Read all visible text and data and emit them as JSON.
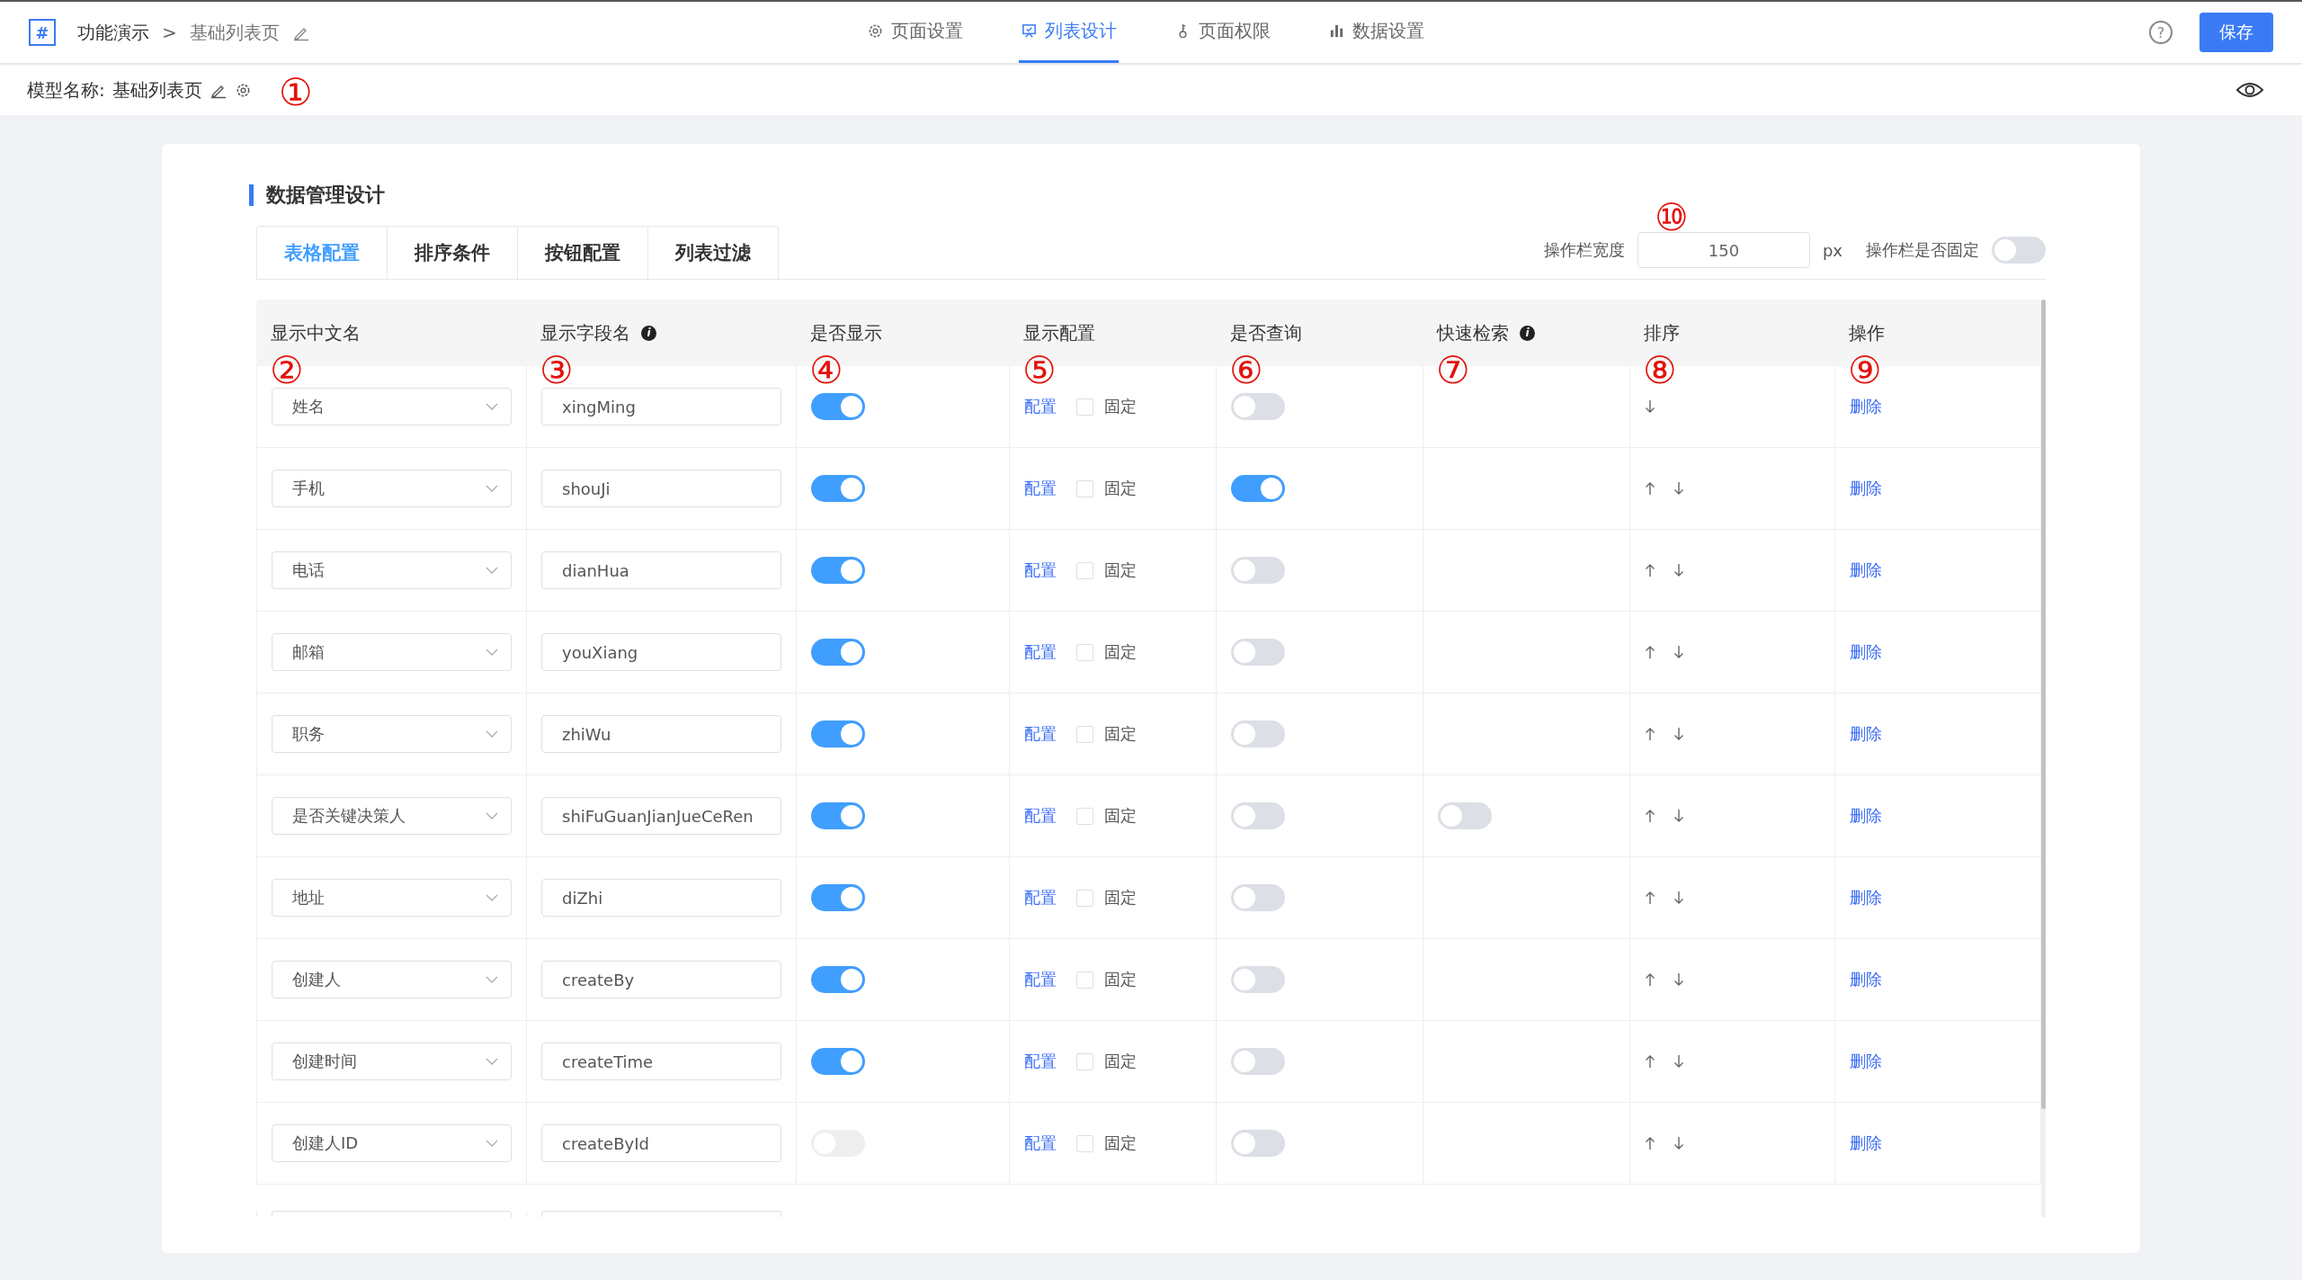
{
  "breadcrumb": {
    "logo": "#",
    "root": "功能演示",
    "separator": ">",
    "current": "基础列表页"
  },
  "nav_tabs": [
    {
      "label": "页面设置",
      "selected": false
    },
    {
      "label": "列表设计",
      "selected": true
    },
    {
      "label": "页面权限",
      "selected": false
    },
    {
      "label": "数据设置",
      "selected": false
    }
  ],
  "help": "?",
  "save_button": "保存",
  "model_name": {
    "label": "模型名称:",
    "value": "基础列表页",
    "callout": "①"
  },
  "section_title": "数据管理设计",
  "config_tabs": [
    {
      "label": "表格配置",
      "selected": true
    },
    {
      "label": "排序条件",
      "selected": false
    },
    {
      "label": "按钮配置",
      "selected": false
    },
    {
      "label": "列表过滤",
      "selected": false
    }
  ],
  "action_width": {
    "label": "操作栏宽度",
    "value": "150",
    "unit": "px",
    "callout": "⑩"
  },
  "action_fixed": {
    "label": "操作栏是否固定",
    "on": false
  },
  "columns": [
    {
      "label": "显示中文名",
      "callout": "②"
    },
    {
      "label": "显示字段名",
      "info": "i",
      "callout": "③"
    },
    {
      "label": "是否显示",
      "callout": "④"
    },
    {
      "label": "显示配置",
      "callout": "⑤"
    },
    {
      "label": "是否查询",
      "callout": "⑥"
    },
    {
      "label": "快速检索",
      "info": "i",
      "callout": "⑦"
    },
    {
      "label": "排序",
      "callout": "⑧"
    },
    {
      "label": "操作",
      "callout": "⑨"
    }
  ],
  "rows": [
    {
      "name": "姓名",
      "field": "xingMing",
      "show": true,
      "config": "配置",
      "fixed": false,
      "fixed_label": "固定",
      "query": false,
      "up": false,
      "down": true,
      "action": "删除"
    },
    {
      "name": "手机",
      "field": "shouJi",
      "show": true,
      "config": "配置",
      "fixed": false,
      "fixed_label": "固定",
      "query": true,
      "up": true,
      "down": true,
      "action": "删除"
    },
    {
      "name": "电话",
      "field": "dianHua",
      "show": true,
      "config": "配置",
      "fixed": false,
      "fixed_label": "固定",
      "query": false,
      "up": true,
      "down": true,
      "action": "删除"
    },
    {
      "name": "邮箱",
      "field": "youXiang",
      "show": true,
      "config": "配置",
      "fixed": false,
      "fixed_label": "固定",
      "query": false,
      "up": true,
      "down": true,
      "action": "删除"
    },
    {
      "name": "职务",
      "field": "zhiWu",
      "show": true,
      "config": "配置",
      "fixed": false,
      "fixed_label": "固定",
      "query": false,
      "up": true,
      "down": true,
      "action": "删除"
    },
    {
      "name": "是否关键决策人",
      "field": "shiFuGuanJianJueCeRen",
      "show": true,
      "config": "配置",
      "fixed": false,
      "fixed_label": "固定",
      "query": false,
      "quick_search": {
        "on": false
      },
      "up": true,
      "down": true,
      "action": "删除"
    },
    {
      "name": "地址",
      "field": "diZhi",
      "show": true,
      "config": "配置",
      "fixed": false,
      "fixed_label": "固定",
      "query": false,
      "up": true,
      "down": true,
      "action": "删除"
    },
    {
      "name": "创建人",
      "field": "createBy",
      "show": true,
      "config": "配置",
      "fixed": false,
      "fixed_label": "固定",
      "query": false,
      "up": true,
      "down": true,
      "action": "删除"
    },
    {
      "name": "创建时间",
      "field": "createTime",
      "show": true,
      "config": "配置",
      "fixed": false,
      "fixed_label": "固定",
      "query": false,
      "up": true,
      "down": true,
      "action": "删除"
    },
    {
      "name": "创建人ID",
      "field": "createById",
      "show": false,
      "config": "配置",
      "fixed": false,
      "fixed_label": "固定",
      "query": false,
      "up": true,
      "down": true,
      "action": "删除"
    }
  ]
}
